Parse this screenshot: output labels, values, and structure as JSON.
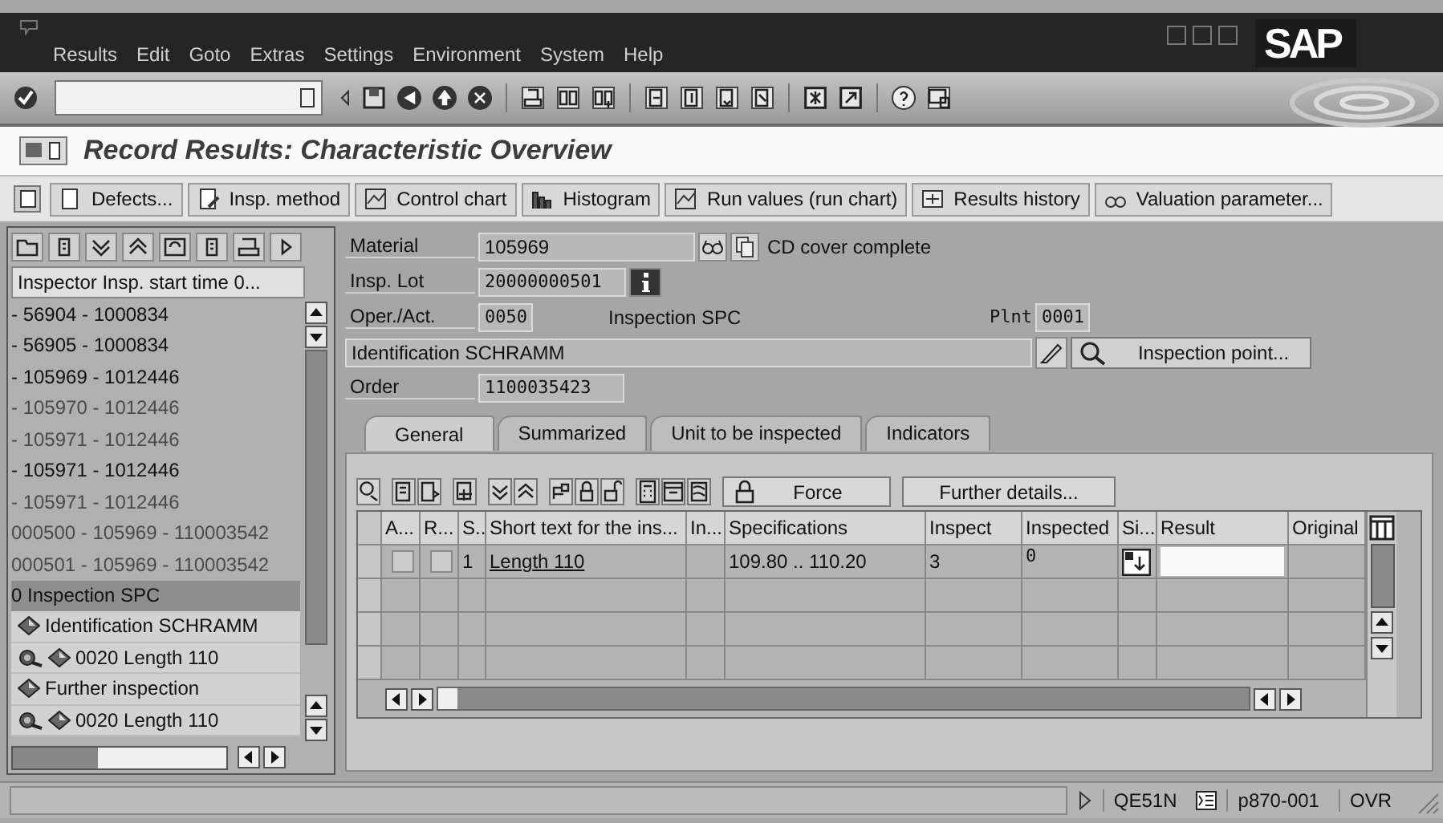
{
  "window": {
    "menu": [
      "Results",
      "Edit",
      "Goto",
      "Extras",
      "Settings",
      "Environment",
      "System",
      "Help"
    ],
    "logo": "SAP"
  },
  "title": "Record Results: Characteristic Overview",
  "app_toolbar": [
    {
      "label": "Defects..."
    },
    {
      "label": "Insp. method"
    },
    {
      "label": "Control chart"
    },
    {
      "label": "Histogram"
    },
    {
      "label": "Run values (run chart)"
    },
    {
      "label": "Results history"
    },
    {
      "label": "Valuation parameter..."
    }
  ],
  "worklist": {
    "column": "Inspector Insp. start time 0...",
    "rows": [
      {
        "text": "- 56904 - 1000834",
        "kind": "lot",
        "greyed": false,
        "selected": false
      },
      {
        "text": "- 56905 - 1000834",
        "kind": "lot",
        "greyed": false,
        "selected": false
      },
      {
        "text": "- 105969 - 1012446",
        "kind": "lot",
        "greyed": false,
        "selected": false
      },
      {
        "text": "- 105970 - 1012446",
        "kind": "lot",
        "greyed": true,
        "selected": false
      },
      {
        "text": "- 105971 - 1012446",
        "kind": "lot",
        "greyed": true,
        "selected": false
      },
      {
        "text": "- 105971 - 1012446",
        "kind": "lot",
        "greyed": false,
        "selected": false
      },
      {
        "text": "- 105971 - 1012446",
        "kind": "lot",
        "greyed": true,
        "selected": false
      },
      {
        "text": "000500 - 105969 - 110003542",
        "kind": "lot",
        "greyed": true,
        "selected": false
      },
      {
        "text": "000501 - 105969 - 110003542",
        "kind": "lot",
        "greyed": true,
        "selected": false
      },
      {
        "text": "0 Inspection SPC",
        "kind": "operation",
        "greyed": false,
        "selected": true
      },
      {
        "text": "Identification SCHRAMM",
        "kind": "characteristic",
        "greyed": false,
        "selected": false
      },
      {
        "text": "0020 Length 110",
        "kind": "characteristic_inspect",
        "greyed": false,
        "selected": false
      },
      {
        "text": "Further inspection",
        "kind": "characteristic",
        "greyed": false,
        "selected": false
      },
      {
        "text": "0020 Length 110",
        "kind": "characteristic_inspect",
        "greyed": false,
        "selected": false
      }
    ]
  },
  "header": {
    "material": {
      "label": "Material",
      "value": "105969",
      "description": "CD cover complete"
    },
    "lot": {
      "label": "Insp. Lot",
      "value": "20000000501"
    },
    "operation": {
      "label": "Oper./Act.",
      "value": "0050",
      "description": "Inspection SPC"
    },
    "plant": {
      "label": "Plnt",
      "value": "0001"
    },
    "identification": "Identification SCHRAMM",
    "inspection_point_button": "Inspection point...",
    "order": {
      "label": "Order",
      "value": "1100035423"
    }
  },
  "tabs": [
    {
      "label": "General",
      "selected": true
    },
    {
      "label": "Summarized",
      "selected": false
    },
    {
      "label": "Unit to be inspected",
      "selected": false
    },
    {
      "label": "Indicators",
      "selected": false
    }
  ],
  "grid": {
    "force_button": "Force",
    "details_button": "Further details...",
    "columns": [
      "A...",
      "R...",
      "S..",
      "Short text for the ins...",
      "In...",
      "Specifications",
      "Inspect",
      "Inspected",
      "Si...",
      "Result",
      "Original"
    ],
    "rows": [
      {
        "a_checked": false,
        "r_checked": false,
        "s": "1",
        "short_text": "Length 110",
        "specifications": "109.80 .. 110.20",
        "inspect": "3",
        "inspected": "0"
      }
    ]
  },
  "status_bar": {
    "transaction": "QE51N",
    "system": "p870-001",
    "mode": "OVR"
  }
}
